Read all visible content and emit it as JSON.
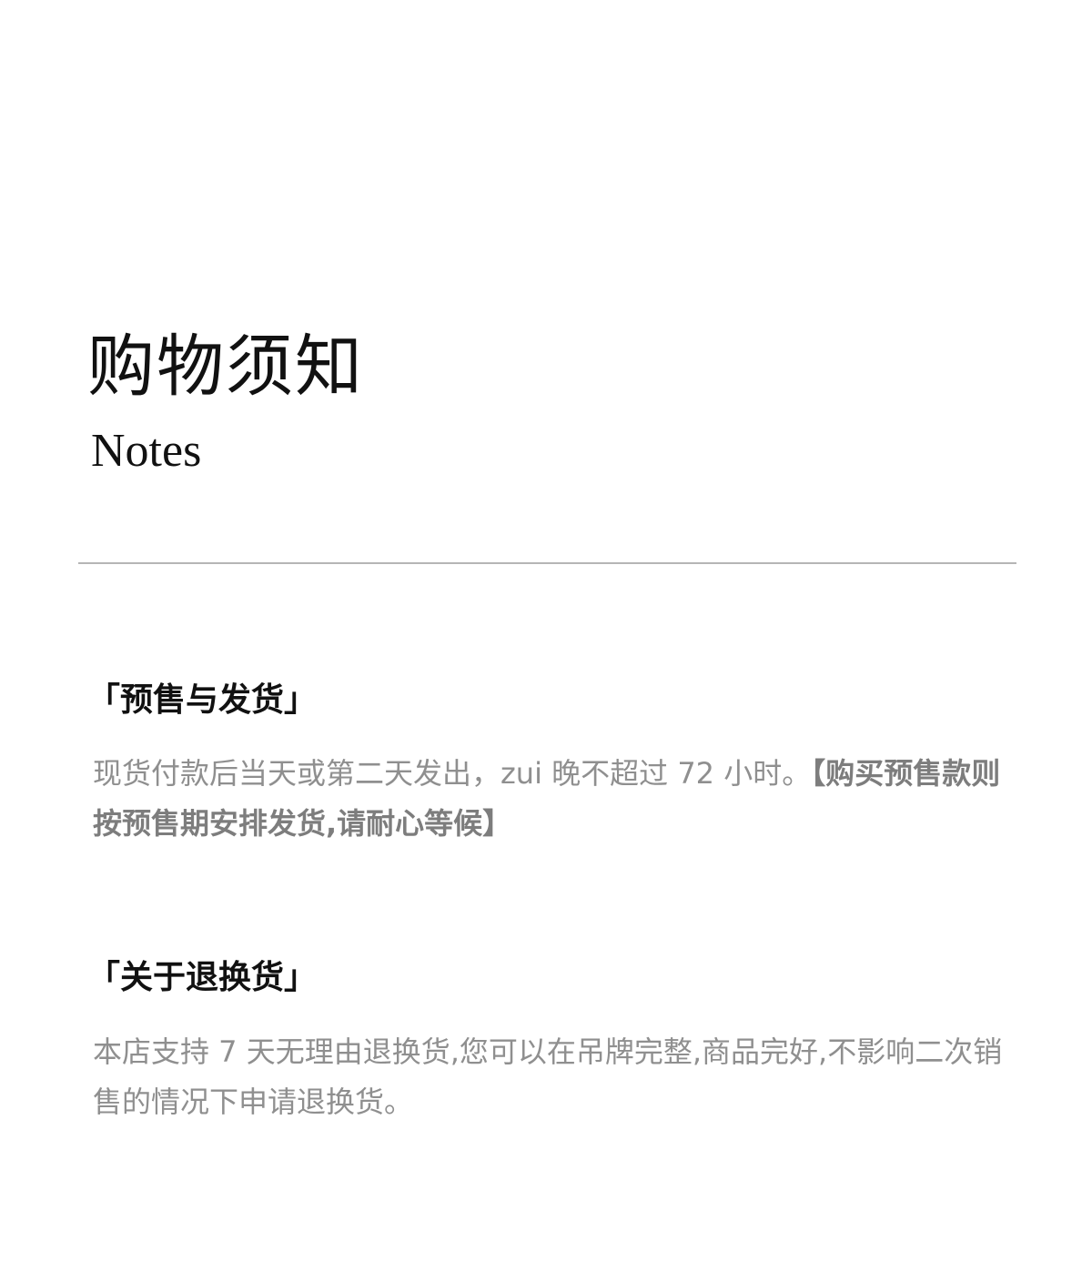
{
  "header": {
    "title_cn": "购物须知",
    "title_en": "Notes"
  },
  "sections": [
    {
      "heading": "「预售与发货」",
      "body_plain": "现货付款后当天或第二天发出，zui 晚不超过 72 小时。",
      "body_emphasis": "【购买预售款则按预售期安排发货,请耐心等候】"
    },
    {
      "heading": "「关于退换货」",
      "body_plain": "本店支持 7 天无理由退换货,您可以在吊牌完整,商品完好,不影响二次销售的情况下申请退换货。"
    }
  ],
  "colors": {
    "heading_text": "#111111",
    "body_text": "#8f8f8f",
    "emphasis_text": "#7d7d7d",
    "divider": "#b5b5b5",
    "background": "#ffffff"
  }
}
